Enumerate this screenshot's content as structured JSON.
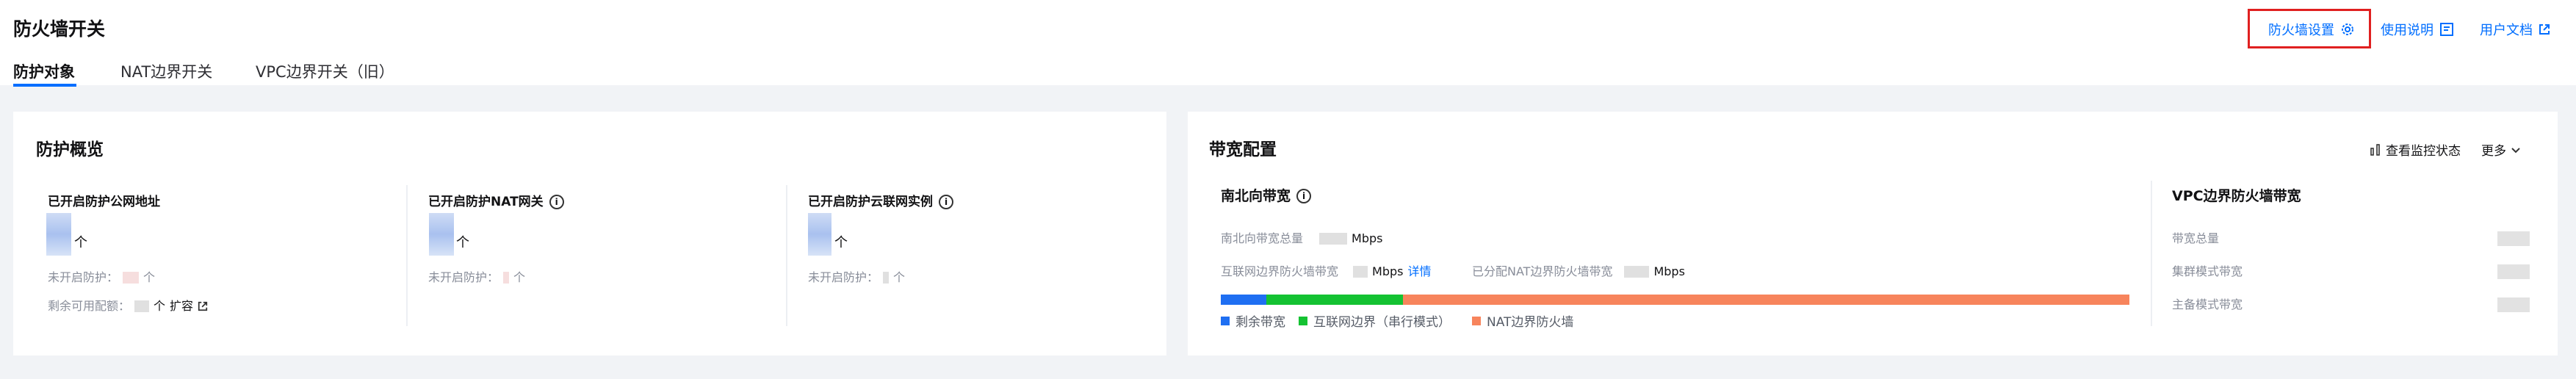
{
  "header": {
    "title": "防火墙开关",
    "tabs": [
      {
        "label": "防护对象",
        "active": true
      },
      {
        "label": "NAT边界开关",
        "active": false
      },
      {
        "label": "VPC边界开关（旧）",
        "active": false
      }
    ],
    "links": {
      "firewall_settings": "防火墙设置",
      "usage_guide": "使用说明",
      "user_docs": "用户文档"
    }
  },
  "overview": {
    "title": "防护概览",
    "stats": [
      {
        "label": "已开启防护公网地址",
        "unit": "个",
        "not_enabled_label": "未开启防护：",
        "not_enabled_unit": "个",
        "remaining_label": "剩余可用配额：",
        "remaining_unit": "个",
        "expand_label": "扩容"
      },
      {
        "label": "已开启防护NAT网关",
        "unit": "个",
        "not_enabled_label": "未开启防护：",
        "not_enabled_unit": "个"
      },
      {
        "label": "已开启防护云联网实例",
        "unit": "个",
        "not_enabled_label": "未开启防护：",
        "not_enabled_unit": "个"
      }
    ]
  },
  "bandwidth": {
    "title": "带宽配置",
    "monitor_label": "查看监控状态",
    "more_label": "更多",
    "north_south": {
      "title": "南北向带宽",
      "total_label": "南北向带宽总量",
      "total_unit": "Mbps",
      "internet_label": "互联网边界防火墙带宽",
      "internet_unit": "Mbps",
      "detail_label": "详情",
      "nat_label": "已分配NAT边界防火墙带宽",
      "nat_unit": "Mbps"
    },
    "usage_bar": [
      {
        "name": "剩余带宽",
        "fraction": 0.05,
        "color": "#1f6ff2"
      },
      {
        "name": "互联网边界（串行模式）",
        "fraction": 0.15,
        "color": "#14c232"
      },
      {
        "name": "NAT边界防火墙",
        "fraction": 0.8,
        "color": "#f7845c"
      }
    ],
    "vpc": {
      "title": "VPC边界防火墙带宽",
      "rows": [
        "带宽总量",
        "集群模式带宽",
        "主备模式带宽"
      ]
    }
  }
}
